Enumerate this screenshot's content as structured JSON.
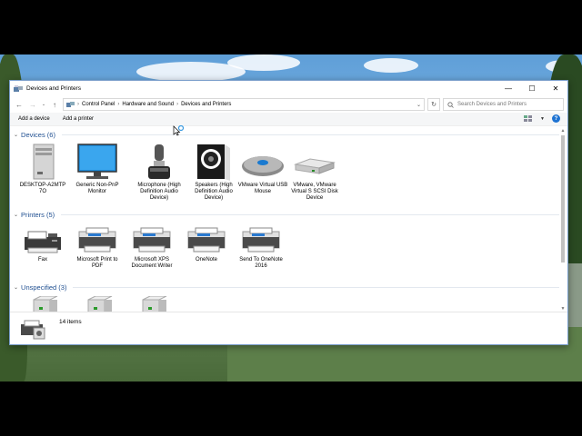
{
  "window": {
    "title": "Devices and Printers",
    "minimize": "—",
    "maximize": "☐",
    "close": "✕"
  },
  "address_bar": {
    "breadcrumb": [
      "Control Panel",
      "Hardware and Sound",
      "Devices and Printers"
    ],
    "search_placeholder": "Search Devices and Printers"
  },
  "commands": {
    "add_device": "Add a device",
    "add_printer": "Add a printer"
  },
  "groups": {
    "devices": {
      "header": "Devices (6)",
      "items": [
        {
          "label": "DESKTOP-A2MTP 7O",
          "icon": "computer-icon"
        },
        {
          "label": "Generic Non-PnP Monitor",
          "icon": "monitor-icon"
        },
        {
          "label": "Microphone (High Definition Audio Device)",
          "icon": "microphone-icon"
        },
        {
          "label": "Speakers (High Definition Audio Device)",
          "icon": "speaker-icon"
        },
        {
          "label": "VMware Virtual USB Mouse",
          "icon": "mouse-icon"
        },
        {
          "label": "VMware, VMware Virtual S SCSI Disk Device",
          "icon": "disk-icon"
        }
      ]
    },
    "printers": {
      "header": "Printers (5)",
      "items": [
        {
          "label": "Fax",
          "icon": "fax-icon"
        },
        {
          "label": "Microsoft Print to PDF",
          "icon": "printer-icon"
        },
        {
          "label": "Microsoft XPS Document Writer",
          "icon": "printer-icon"
        },
        {
          "label": "OneNote",
          "icon": "printer-icon"
        },
        {
          "label": "Send To OneNote 2016",
          "icon": "printer-icon"
        }
      ]
    },
    "unspecified": {
      "header": "Unspecified (3)"
    }
  },
  "status": {
    "item_count": "14 items"
  }
}
